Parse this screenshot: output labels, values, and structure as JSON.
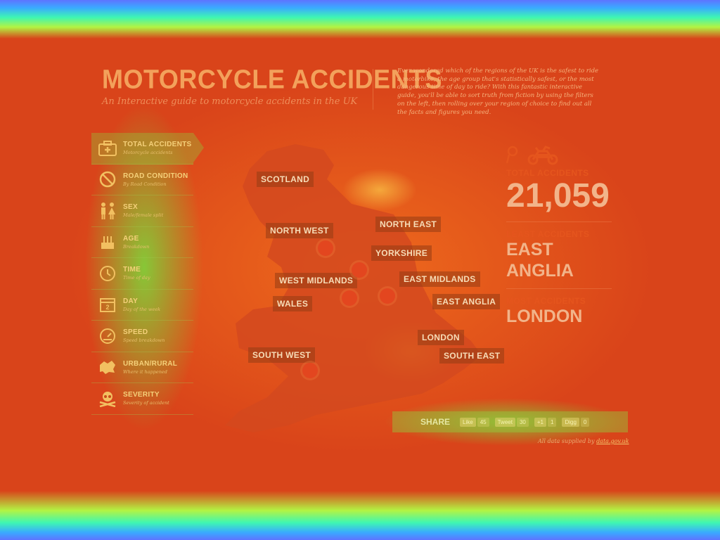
{
  "header": {
    "title": "MOTORCYCLE ACCIDENTS",
    "subtitle": "An Interactive guide to motorcycle accidents in the UK",
    "intro": "Ever wondered which of the regions of the UK is the safest to ride a motorbike, the age group that's statistically safest, or the most dangerous time of day to ride? With this fantastic interactive guide, you'll be able to sort truth from fiction by using the filters on the left, then rolling over your region of choice to find out all the facts and figures you need."
  },
  "sidebar": {
    "items": [
      {
        "label": "TOTAL ACCIDENTS",
        "sub": "Motorcycle accidents",
        "icon": "first-aid-kit-icon",
        "active": true
      },
      {
        "label": "ROAD CONDITION",
        "sub": "By Road Condition",
        "icon": "no-entry-icon"
      },
      {
        "label": "SEX",
        "sub": "Male/female split",
        "icon": "male-female-icon"
      },
      {
        "label": "AGE",
        "sub": "Breakdown",
        "icon": "birthday-cake-icon"
      },
      {
        "label": "TIME",
        "sub": "Time of day",
        "icon": "clock-icon"
      },
      {
        "label": "DAY",
        "sub": "Day of the week",
        "icon": "calendar-icon"
      },
      {
        "label": "SPEED",
        "sub": "Speed breakdown",
        "icon": "speedometer-icon"
      },
      {
        "label": "URBAN/RURAL",
        "sub": "Where it happened",
        "icon": "map-area-icon"
      },
      {
        "label": "SEVERITY",
        "sub": "Severity of accident",
        "icon": "skull-icon"
      }
    ]
  },
  "map": {
    "regions": [
      {
        "name": "SCOTLAND"
      },
      {
        "name": "NORTH EAST"
      },
      {
        "name": "NORTH WEST"
      },
      {
        "name": "YORKSHIRE"
      },
      {
        "name": "EAST MIDLANDS"
      },
      {
        "name": "WEST MIDLANDS"
      },
      {
        "name": "WALES"
      },
      {
        "name": "EAST ANGLIA"
      },
      {
        "name": "LONDON"
      },
      {
        "name": "SOUTH EAST"
      },
      {
        "name": "SOUTH WEST"
      }
    ]
  },
  "stats": {
    "total_label": "TOTAL ACCIDENTS",
    "total_value": "21,059",
    "least_label": "LEAST ACCIDENTS",
    "least_value": "EAST ANGLIA",
    "most_label": "MOST ACCIDENTS",
    "most_value": "LONDON"
  },
  "share": {
    "label": "SHARE",
    "like_label": "Like",
    "like_count": "45",
    "tweet_label": "Tweet",
    "tweet_count": "30",
    "plus_label": "+1",
    "plus_count": "1",
    "digg_label": "Digg",
    "digg_count": "0"
  },
  "footer": {
    "credit_text": "All data supplied by",
    "credit_link": "data.gov.uk"
  },
  "colors": {
    "heat_base": "#e24a16",
    "heat_green": "#8cd23c",
    "band_blue": "#5e74ff"
  }
}
